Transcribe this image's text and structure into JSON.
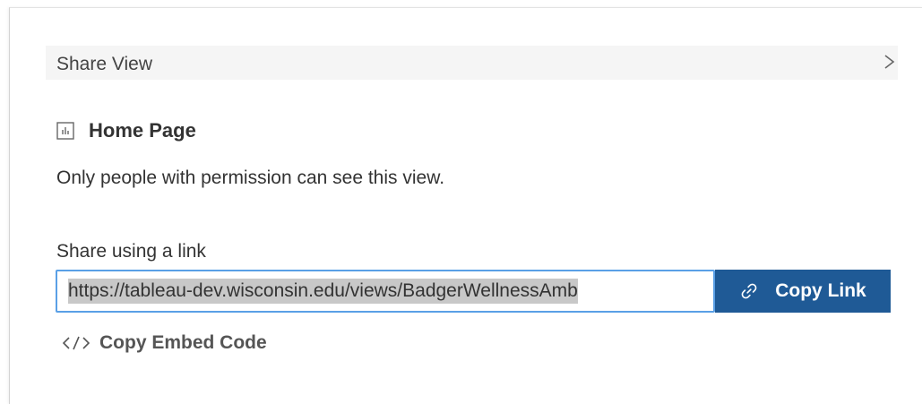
{
  "dialog": {
    "title": "Share View"
  },
  "view": {
    "name": "Home Page",
    "icon": "bar-chart-icon"
  },
  "permission": {
    "text": "Only people with permission can see this view."
  },
  "share_link": {
    "label": "Share using a link",
    "url": "https://tableau-dev.wisconsin.edu/views/BadgerWellnessAmb",
    "copy_label": "Copy Link"
  },
  "embed": {
    "label": "Copy Embed Code"
  },
  "colors": {
    "primary_button": "#1f5a96",
    "input_focus_border": "#5aa0e6",
    "header_bg": "#f5f5f5",
    "selection_bg": "#c8c8c8"
  }
}
